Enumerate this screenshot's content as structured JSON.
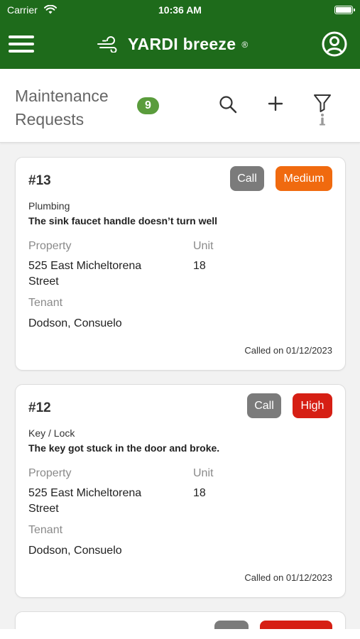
{
  "status_bar": {
    "carrier": "Carrier",
    "time": "10:36 AM",
    "battery_level": 1.0
  },
  "header": {
    "brand_name": "YARDI breeze",
    "brand_mark": "®",
    "brand_color": "#1e6b1b",
    "icons": [
      "menu-icon",
      "wind-icon",
      "profile-icon"
    ]
  },
  "subheader": {
    "title": "Maintenance Requests",
    "count": "9",
    "count_color": "#5a9c3c",
    "icons": [
      "search-icon",
      "plus-icon",
      "filter-icon"
    ]
  },
  "labels": {
    "property": "Property",
    "unit": "Unit",
    "tenant": "Tenant",
    "call": "Call"
  },
  "requests": [
    {
      "number": "#13",
      "priority": "Medium",
      "priority_color": "#f06a0f",
      "category": "Plumbing",
      "description": "The sink faucet handle doesn’t turn well",
      "property": "525 East Micheltorena Street",
      "unit": "18",
      "tenant": "Dodson, Consuelo",
      "called_on": "Called on 01/12/2023"
    },
    {
      "number": "#12",
      "priority": "High",
      "priority_color": "#d61f14",
      "category": "Key / Lock",
      "description": "The key got stuck in the door and broke.",
      "property": "525 East Micheltorena Street",
      "unit": "18",
      "tenant": "Dodson, Consuelo",
      "called_on": "Called on 01/12/2023"
    }
  ]
}
